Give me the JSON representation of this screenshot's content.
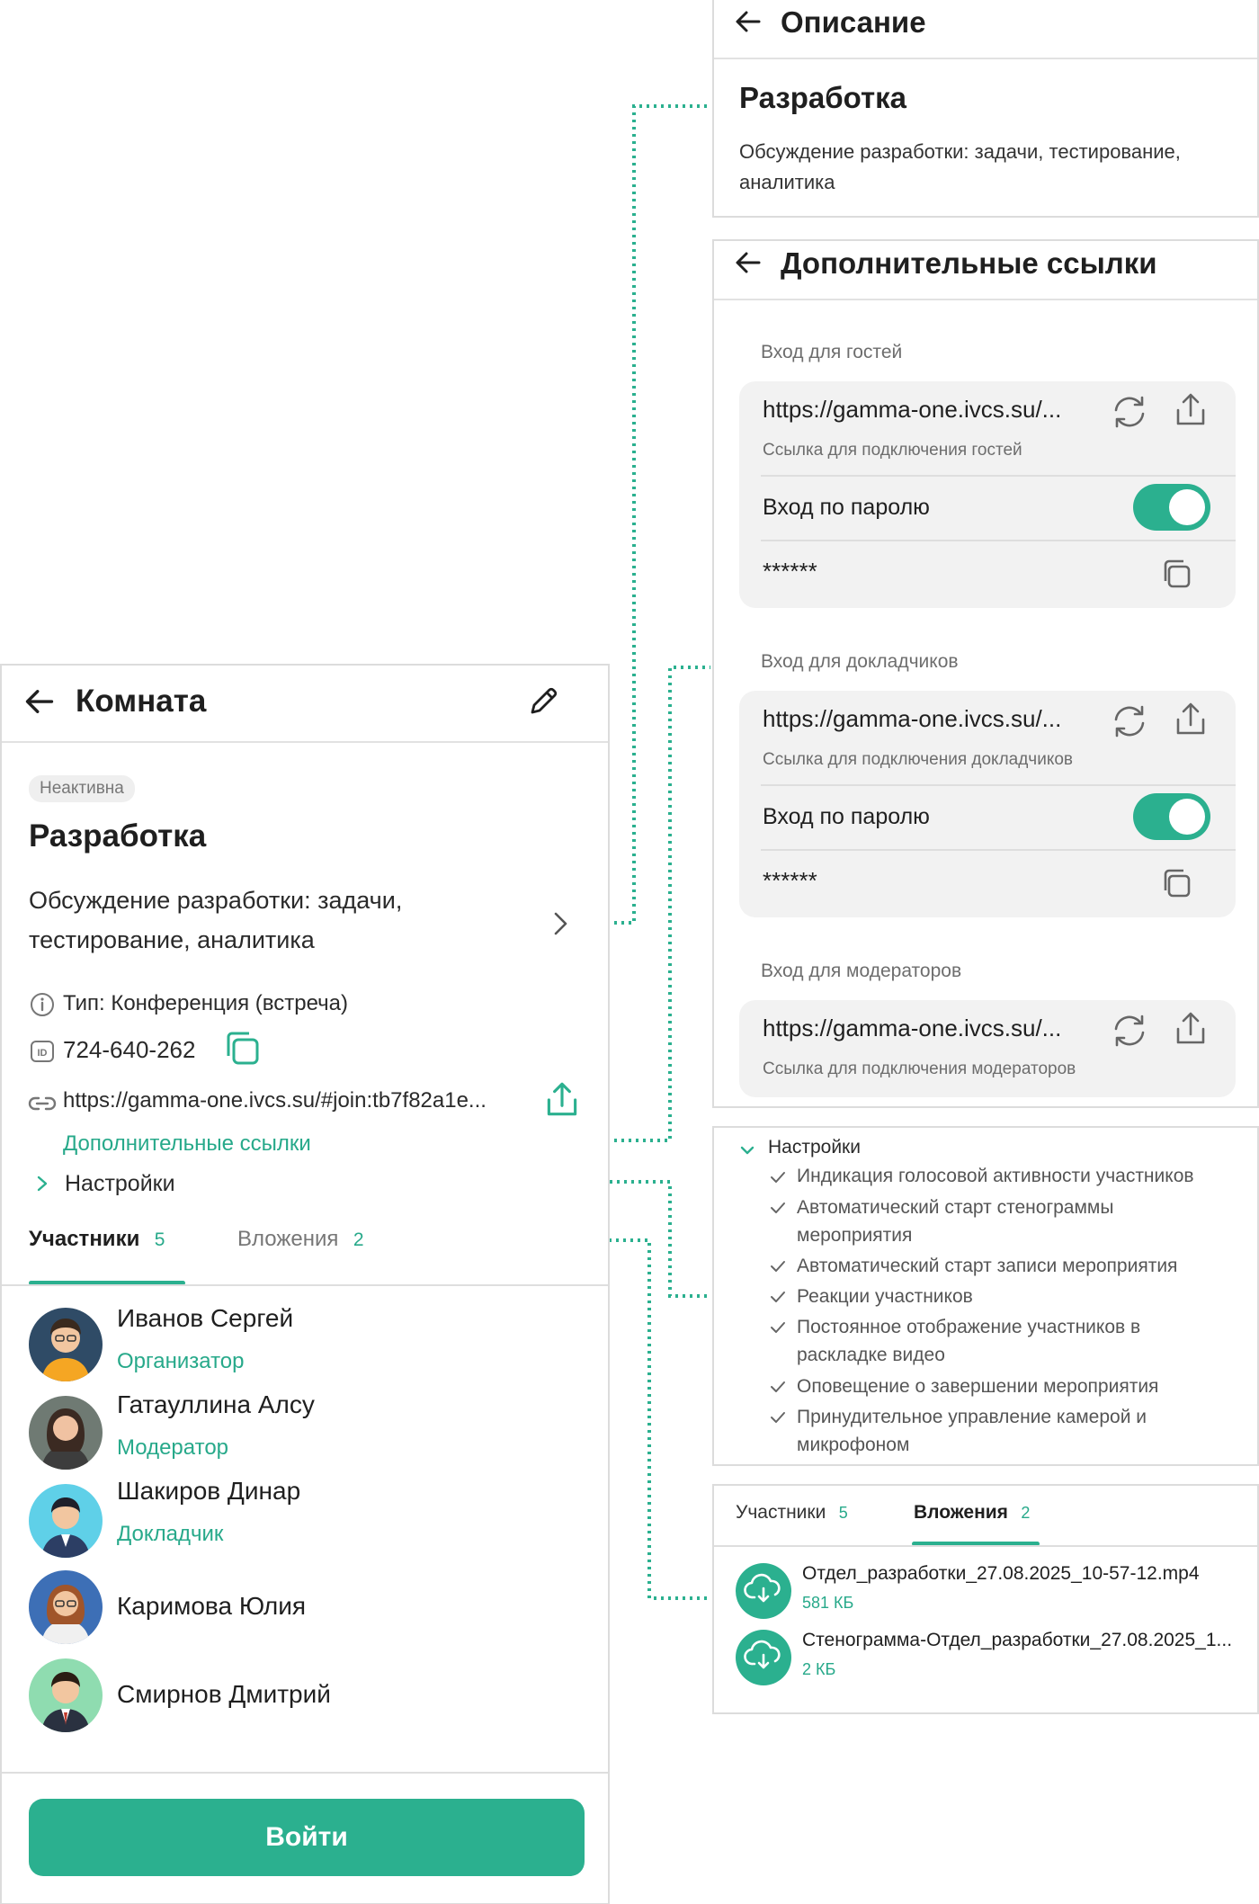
{
  "description_panel": {
    "title": "Описание",
    "name": "Разработка",
    "text_line1": "Обсуждение разработки: задачи, тестирование,",
    "text_line2": "аналитика"
  },
  "links_panel": {
    "title": "Дополнительные ссылки",
    "sections": [
      {
        "label": "Вход для гостей",
        "url": "https://gamma-one.ivcs.su/...",
        "caption": "Ссылка для подключения гостей",
        "password_label": "Вход по паролю",
        "password_enabled": true,
        "password": "******"
      },
      {
        "label": "Вход для докладчиков",
        "url": "https://gamma-one.ivcs.su/...",
        "caption": "Ссылка для подключения докладчиков",
        "password_label": "Вход по паролю",
        "password_enabled": true,
        "password": "******"
      },
      {
        "label": "Вход для модераторов",
        "url": "https://gamma-one.ivcs.su/...",
        "caption": "Ссылка для подключения модераторов"
      }
    ]
  },
  "room": {
    "title": "Комната",
    "status": "Неактивна",
    "name": "Разработка",
    "desc_line1": "Обсуждение разработки: задачи,",
    "desc_line2": "тестирование, аналитика",
    "type": "Тип: Конференция (встреча)",
    "id": "724-640-262",
    "link": "https://gamma-one.ivcs.su/#join:tb7f82a1e...",
    "extra_links": "Дополнительные ссылки",
    "settings": "Настройки",
    "tabs": [
      {
        "label": "Участники",
        "count": "5"
      },
      {
        "label": "Вложения",
        "count": "2"
      }
    ],
    "participants": [
      {
        "name": "Иванов Сергей",
        "role": "Организатор"
      },
      {
        "name": "Гатауллина Алсу",
        "role": "Модератор"
      },
      {
        "name": "Шакиров Динар",
        "role": "Докладчик"
      },
      {
        "name": "Каримова Юлия",
        "role": ""
      },
      {
        "name": "Смирнов Дмитрий",
        "role": ""
      }
    ],
    "join_button": "Войти"
  },
  "settings_panel": {
    "title": "Настройки",
    "items": [
      "Индикация голосовой активности участников",
      "Автоматический старт стенограммы",
      "мероприятия",
      "Автоматический старт записи мероприятия",
      "Реакции участников",
      "Постоянное отображение участников в",
      "раскладке видео",
      "Оповещение о завершении мероприятия",
      "Принудительное управление камерой и",
      "микрофоном"
    ]
  },
  "attachments_panel": {
    "tabs": [
      {
        "label": "Участники",
        "count": "5"
      },
      {
        "label": "Вложения",
        "count": "2"
      }
    ],
    "files": [
      {
        "name": "Отдел_разработки_27.08.2025_10-57-12.mp4",
        "size": "581 КБ"
      },
      {
        "name": "Стенограмма-Отдел_разработки_27.08.2025_1...",
        "size": "2 КБ"
      }
    ]
  },
  "colors": {
    "accent": "#2bb08f",
    "accent_text": "#27a98a",
    "border": "#dcdcdc",
    "card": "#f2f2f2"
  },
  "icons": [
    "back-arrow-icon",
    "pencil-icon",
    "refresh-icon",
    "share-icon",
    "copy-icon",
    "info-icon",
    "id-icon",
    "link-icon",
    "chevron-right-icon",
    "chevron-down-icon",
    "check-icon",
    "download-icon"
  ]
}
